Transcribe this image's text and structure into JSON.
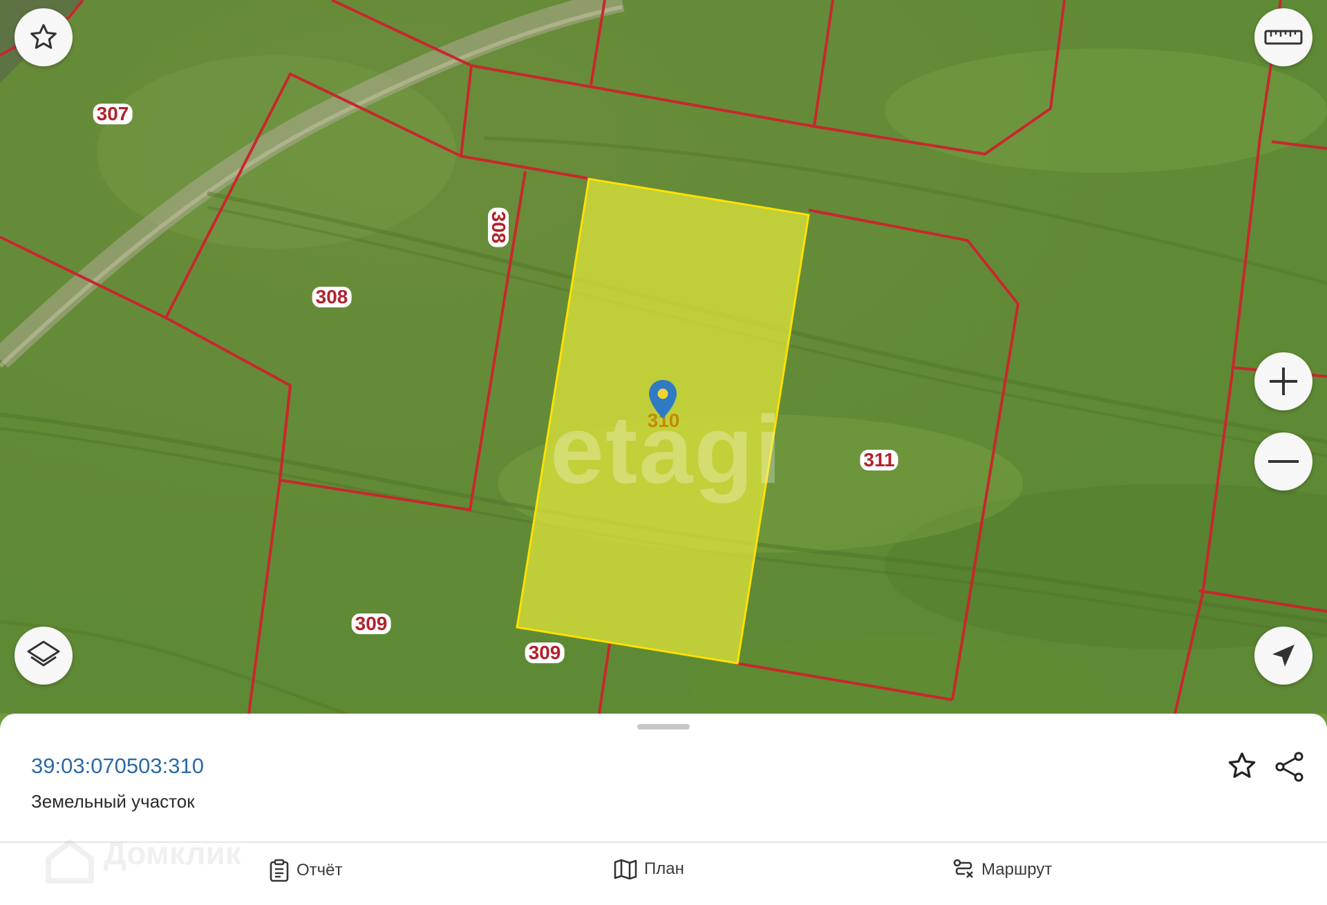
{
  "map": {
    "plot_labels": [
      {
        "id": "307",
        "text": "307"
      },
      {
        "id": "308-vertical",
        "text": "308"
      },
      {
        "id": "308",
        "text": "308"
      },
      {
        "id": "310",
        "text": "310"
      },
      {
        "id": "311",
        "text": "311"
      },
      {
        "id": "309-left",
        "text": "309"
      },
      {
        "id": "309-bottom",
        "text": "309"
      }
    ],
    "watermark": "etagi",
    "colors": {
      "boundary": "#c8272e",
      "selected_fill": "#e3e83a",
      "selected_stroke": "#ffe100",
      "pin": "#2e7bc4"
    },
    "buttons": {
      "favorite": "star-icon",
      "ruler": "ruler-icon",
      "zoom_in": "plus-icon",
      "zoom_out": "minus-icon",
      "layers": "layers-icon",
      "locate": "location-arrow-icon"
    }
  },
  "panel": {
    "cadastral_number": "39:03:070503:310",
    "object_type": "Земельный участок",
    "watermark": "Домклик",
    "tabs": [
      {
        "label": "Отчёт",
        "icon": "report-icon"
      },
      {
        "label": "План",
        "icon": "map-plan-icon"
      },
      {
        "label": "Маршрут",
        "icon": "route-icon"
      }
    ]
  }
}
